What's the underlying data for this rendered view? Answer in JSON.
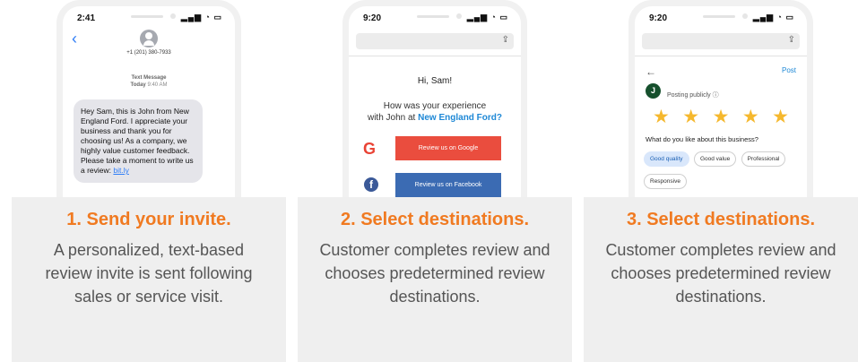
{
  "steps": [
    {
      "title": "1. Send your invite.",
      "description": "A personalized, text-based review invite is sent following sales or service visit."
    },
    {
      "title": "2. Select destinations.",
      "description": "Customer completes review and chooses predetermined review destinations."
    },
    {
      "title": "3. Select destinations.",
      "description": "Customer completes review and chooses predetermined review destinations."
    }
  ],
  "phone1": {
    "time": "2:41",
    "contact_number": "+1 (201) 380-7933",
    "message_type": "Text Message",
    "message_date_day": "Today",
    "message_date_time": "9:40 AM",
    "message_text": "Hey Sam, this is John from New England Ford. I appreciate your business and thank you for choosing us! As a company, we highly value customer feedback. Please take a moment to write us a review:",
    "link_text": "bit.ly"
  },
  "phone2": {
    "time": "9:20",
    "greeting": "Hi, Sam!",
    "question_part1": "How was your experience",
    "question_part2": "with John at",
    "brand": "New England Ford?",
    "google_button": "Review us on Google",
    "facebook_button": "Review us on Facebook"
  },
  "phone3": {
    "time": "9:20",
    "post_label": "Post",
    "avatar_letter": "J",
    "posting_label": "Posting publicly",
    "rating": 5,
    "rating_max": 5,
    "question": "What do you like about this business?",
    "chips": [
      "Good quality",
      "Good value",
      "Professional",
      "Responsive"
    ],
    "selected_chip": "Good quality"
  },
  "colors": {
    "accent": "#f07a21",
    "card_bg": "#efefef",
    "star": "#f5b82e",
    "google_red": "#ea4d3e",
    "facebook_blue": "#3b6bb3",
    "link_blue": "#1e88d6"
  }
}
